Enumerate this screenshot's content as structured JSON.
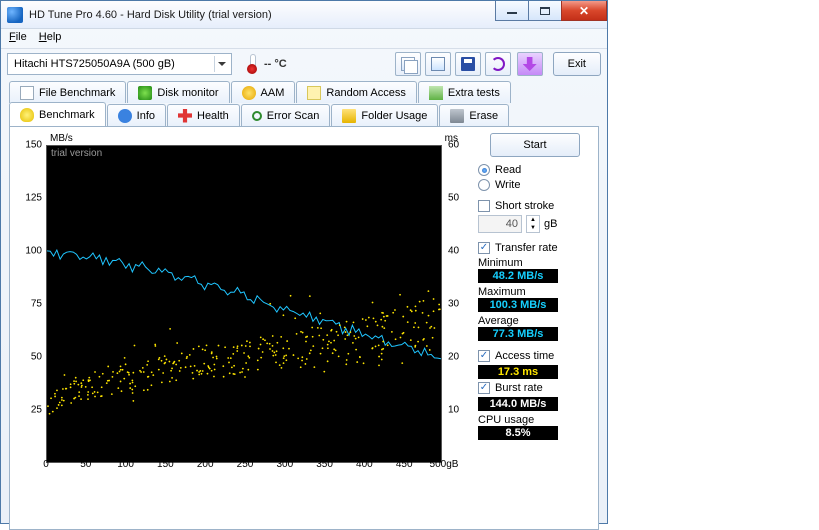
{
  "window": {
    "title": "HD Tune Pro 4.60 - Hard Disk Utility (trial version)"
  },
  "menu": {
    "file": "File",
    "help": "Help"
  },
  "drive": {
    "label": "Hitachi HTS725050A9A   (500 gB)"
  },
  "temperature": {
    "value": "-- °C"
  },
  "exitBtn": "Exit",
  "tabsTop": [
    {
      "label": "File Benchmark"
    },
    {
      "label": "Disk monitor"
    },
    {
      "label": "AAM"
    },
    {
      "label": "Random Access"
    },
    {
      "label": "Extra tests"
    }
  ],
  "tabsBottom": [
    {
      "label": "Benchmark"
    },
    {
      "label": "Info"
    },
    {
      "label": "Health"
    },
    {
      "label": "Error Scan"
    },
    {
      "label": "Folder Usage"
    },
    {
      "label": "Erase"
    }
  ],
  "controls": {
    "start": "Start",
    "read": "Read",
    "write": "Write",
    "shortStroke": "Short stroke",
    "shortStrokeVal": "40",
    "shortStrokeUnit": "gB",
    "transferRate": "Transfer rate",
    "minimumLbl": "Minimum",
    "minimumVal": "48.2 MB/s",
    "maximumLbl": "Maximum",
    "maximumVal": "100.3 MB/s",
    "averageLbl": "Average",
    "averageVal": "77.3 MB/s",
    "accessTime": "Access time",
    "accessTimeVal": "17.3 ms",
    "burstRate": "Burst rate",
    "burstRateVal": "144.0 MB/s",
    "cpuUsage": "CPU usage",
    "cpuUsageVal": "8.5%"
  },
  "chart": {
    "trial": "trial version",
    "leftUnit": "MB/s",
    "rightUnit": "ms",
    "leftTicks": [
      "150",
      "125",
      "100",
      "75",
      "50",
      "25"
    ],
    "rightTicks": [
      "60",
      "50",
      "40",
      "30",
      "20",
      "10"
    ],
    "xTicks": [
      "0",
      "50",
      "100",
      "150",
      "200",
      "250",
      "300",
      "350",
      "400",
      "450",
      "500gB"
    ]
  },
  "chart_data": {
    "type": "line",
    "title": "HD Tune Benchmark",
    "x_unit": "gB",
    "xlim": [
      0,
      500
    ],
    "series": [
      {
        "name": "Transfer rate",
        "unit": "MB/s",
        "y_axis": "left",
        "ylim": [
          0,
          150
        ],
        "style": "line",
        "x": [
          0,
          25,
          50,
          75,
          100,
          125,
          150,
          175,
          200,
          225,
          250,
          275,
          300,
          325,
          350,
          375,
          400,
          425,
          450,
          475,
          500
        ],
        "values": [
          100,
          99,
          97,
          96,
          94,
          92,
          90,
          88,
          85,
          82,
          79,
          76,
          73,
          70,
          67,
          64,
          61,
          58,
          55,
          52,
          49
        ]
      },
      {
        "name": "Access time",
        "unit": "ms",
        "y_axis": "right",
        "ylim": [
          0,
          60
        ],
        "style": "scatter",
        "x": [
          0,
          25,
          50,
          75,
          100,
          125,
          150,
          175,
          200,
          225,
          250,
          275,
          300,
          325,
          350,
          375,
          400,
          425,
          450,
          475,
          500
        ],
        "values": [
          10,
          12,
          13,
          14,
          15,
          15,
          17,
          17,
          18,
          18,
          19,
          19,
          20,
          20,
          20,
          21,
          21,
          22,
          23,
          24,
          26
        ]
      }
    ],
    "summary": {
      "transfer_min_MBps": 48.2,
      "transfer_max_MBps": 100.3,
      "transfer_avg_MBps": 77.3,
      "access_time_ms": 17.3,
      "burst_rate_MBps": 144.0,
      "cpu_usage_pct": 8.5
    }
  }
}
